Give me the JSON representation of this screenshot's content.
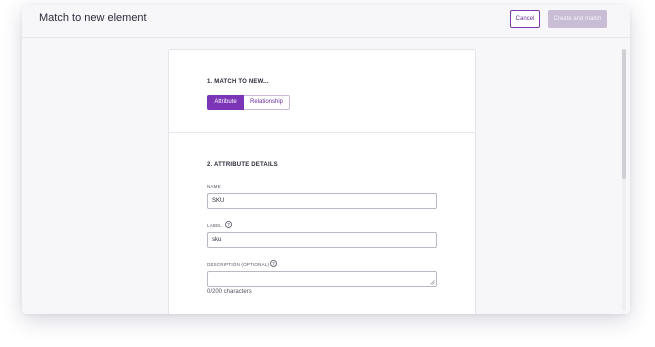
{
  "header": {
    "title": "Match to new element",
    "cancel_label": "Cancel",
    "create_label": "Create and match"
  },
  "section1": {
    "heading": "1. MATCH TO NEW...",
    "options": [
      "Attribute",
      "Relationship"
    ],
    "selected": "Attribute"
  },
  "section2": {
    "heading": "2. ATTRIBUTE DETAILS",
    "name": {
      "label": "NAME",
      "value": "SKU"
    },
    "label_field": {
      "label": "LABEL",
      "value": "sku",
      "help_icon": "question-circle-icon"
    },
    "description": {
      "label": "DESCRIPTION (OPTIONAL)",
      "value": "",
      "help_icon": "question-circle-icon",
      "char_count": "0/200 characters"
    }
  },
  "colors": {
    "accent": "#7b35b6",
    "disabled_button": "#c9bdd6"
  }
}
